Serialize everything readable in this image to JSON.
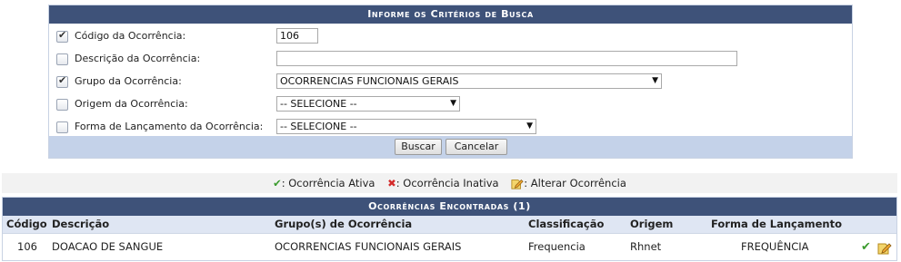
{
  "search_form": {
    "title": "Informe os Critérios de Busca",
    "fields": {
      "codigo": {
        "label": "Código da Ocorrência:",
        "checked": true,
        "value": "106"
      },
      "descricao": {
        "label": "Descrição da Ocorrência:",
        "checked": false,
        "value": ""
      },
      "grupo": {
        "label": "Grupo da Ocorrência:",
        "checked": true,
        "selected": "OCORRENCIAS FUNCIONAIS GERAIS"
      },
      "origem": {
        "label": "Origem da Ocorrência:",
        "checked": false,
        "selected": "-- SELECIONE --"
      },
      "forma": {
        "label": "Forma de Lançamento da Ocorrência:",
        "checked": false,
        "selected": "-- SELECIONE --"
      }
    },
    "buttons": {
      "search": "Buscar",
      "cancel": "Cancelar"
    }
  },
  "legend": {
    "active": ": Ocorrência Ativa",
    "inactive": ": Ocorrência Inativa",
    "edit": ": Alterar Ocorrência"
  },
  "results": {
    "title": "Ocorrências Encontradas (1)",
    "columns": [
      "Código",
      "Descrição",
      "Grupo(s) de Ocorrência",
      "Classificação",
      "Origem",
      "Forma de Lançamento"
    ],
    "rows": [
      {
        "codigo": "106",
        "descricao": "DOACAO DE SANGUE",
        "grupo": "OCORRENCIAS FUNCIONAIS GERAIS",
        "classificacao": "Frequencia",
        "origem": "Rhnet",
        "forma": "FREQUÊNCIA",
        "status_icon": "check-icon",
        "edit_icon": "edit-icon"
      }
    ]
  },
  "colors": {
    "caption_bg": "#3e5279",
    "form_footer_bg": "#c4d2e9",
    "table_header_bg": "#dfe6f3",
    "active_icon": "#3b9b2e",
    "inactive_icon": "#d42a2a"
  }
}
